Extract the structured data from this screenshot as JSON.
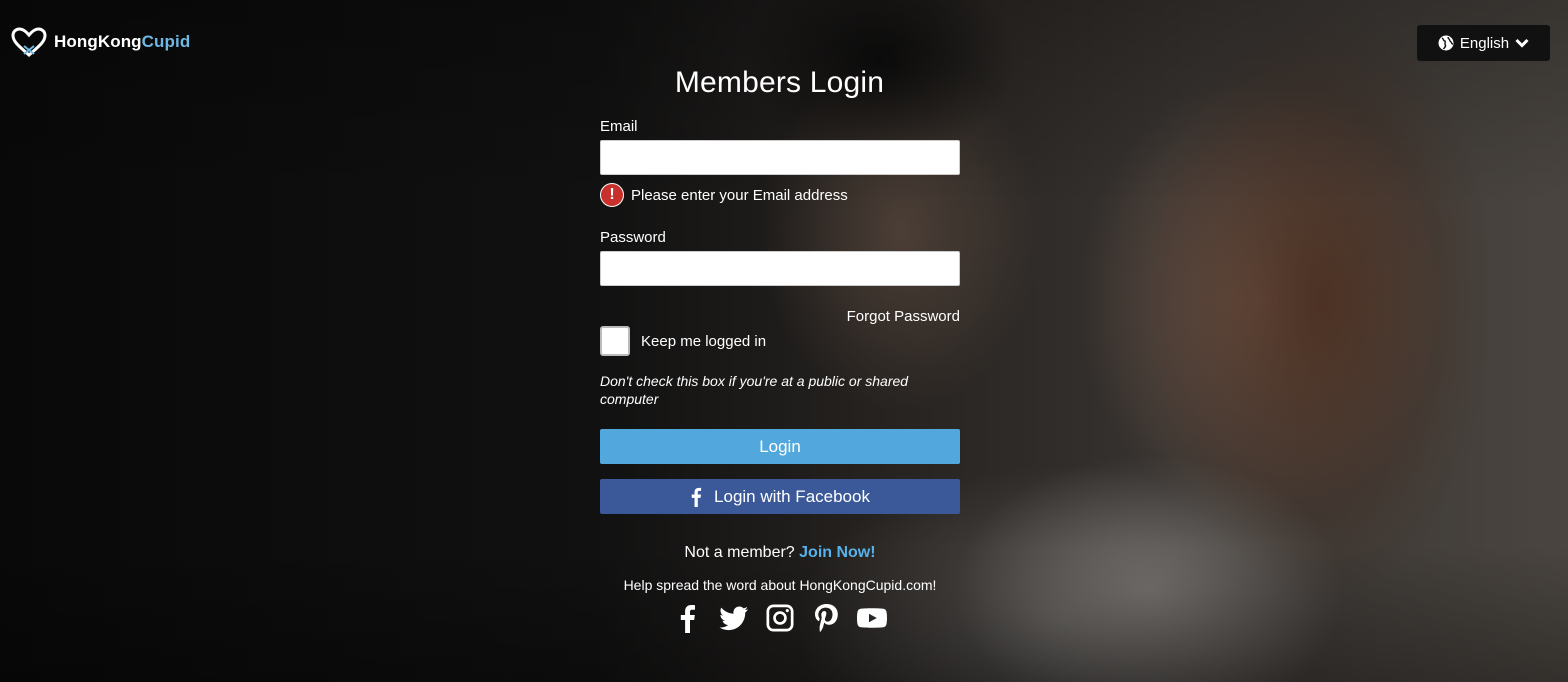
{
  "brand": {
    "part1": "HongKong",
    "part2": "Cupid",
    "logo_icon": "heart-logo-icon"
  },
  "language": {
    "label": "English",
    "icon": "globe-icon",
    "chevron": "chevron-down-icon"
  },
  "login_form": {
    "title": "Members Login",
    "email_label": "Email",
    "email_value": "",
    "email_error": "Please enter your Email address",
    "error_glyph": "!",
    "password_label": "Password",
    "password_value": "",
    "forgot_password": "Forgot Password",
    "keep_logged_in": "Keep me logged in",
    "keep_logged_in_checked": false,
    "keep_note": "Don't check this box if you're at a public or shared computer",
    "login_button": "Login",
    "facebook_button": "Login with Facebook"
  },
  "signup": {
    "prompt": "Not a member?",
    "link": "Join Now!"
  },
  "share": {
    "text": "Help spread the word about HongKongCupid.com!",
    "icons": [
      "facebook-icon",
      "twitter-icon",
      "instagram-icon",
      "pinterest-icon",
      "youtube-icon"
    ]
  },
  "colors": {
    "login_button": "#52a8dc",
    "facebook_button": "#3b5998",
    "link": "#56b2ea",
    "error": "#c8302c",
    "brand_accent": "#6fb7e4"
  }
}
